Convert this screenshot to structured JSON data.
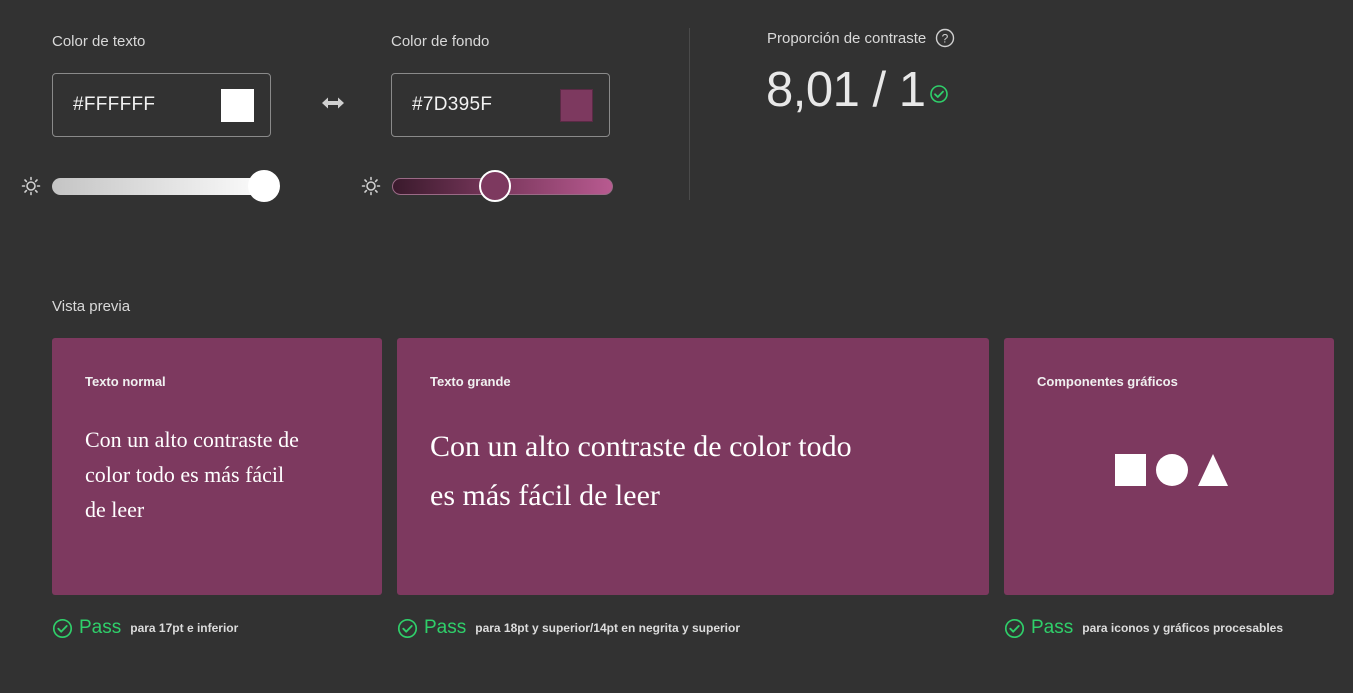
{
  "text_color": {
    "label": "Color de texto",
    "hex_display": "#FFFFFF",
    "swatch": "#FFFFFF",
    "brightness_level": 1.0
  },
  "background_color": {
    "label": "Color de fondo",
    "hex_display": "#7D395F",
    "swatch": "#7D395F",
    "brightness_level": 0.5
  },
  "icons": {
    "swap": "swap-arrows-icon",
    "brightness": "sun-icon",
    "help": "help-circle-icon",
    "check": "check-circle-icon"
  },
  "contrast": {
    "label": "Proporción de contraste",
    "value": "8,01 / 1",
    "status_color": "#2FCF6A"
  },
  "preview": {
    "title": "Vista previa",
    "cards": [
      {
        "title": "Texto normal",
        "sample_lines": [
          "Con un alto contraste de",
          "color todo es más fácil",
          "de leer"
        ]
      },
      {
        "title": "Texto grande",
        "sample_lines": [
          "Con un alto contraste de color todo",
          "es más fácil de leer"
        ]
      },
      {
        "title": "Componentes gráficos",
        "shapes": [
          "square",
          "circle",
          "triangle"
        ]
      }
    ]
  },
  "results": [
    {
      "status": "Pass",
      "description": "para 17pt e inferior"
    },
    {
      "status": "Pass",
      "description": "para 18pt y superior/14pt en negrita y superior"
    },
    {
      "status": "Pass",
      "description": "para iconos y gráficos procesables"
    }
  ],
  "colors": {
    "page_background": "#323232",
    "card_background": "#7D395F",
    "pass_green": "#2FCF6A"
  }
}
